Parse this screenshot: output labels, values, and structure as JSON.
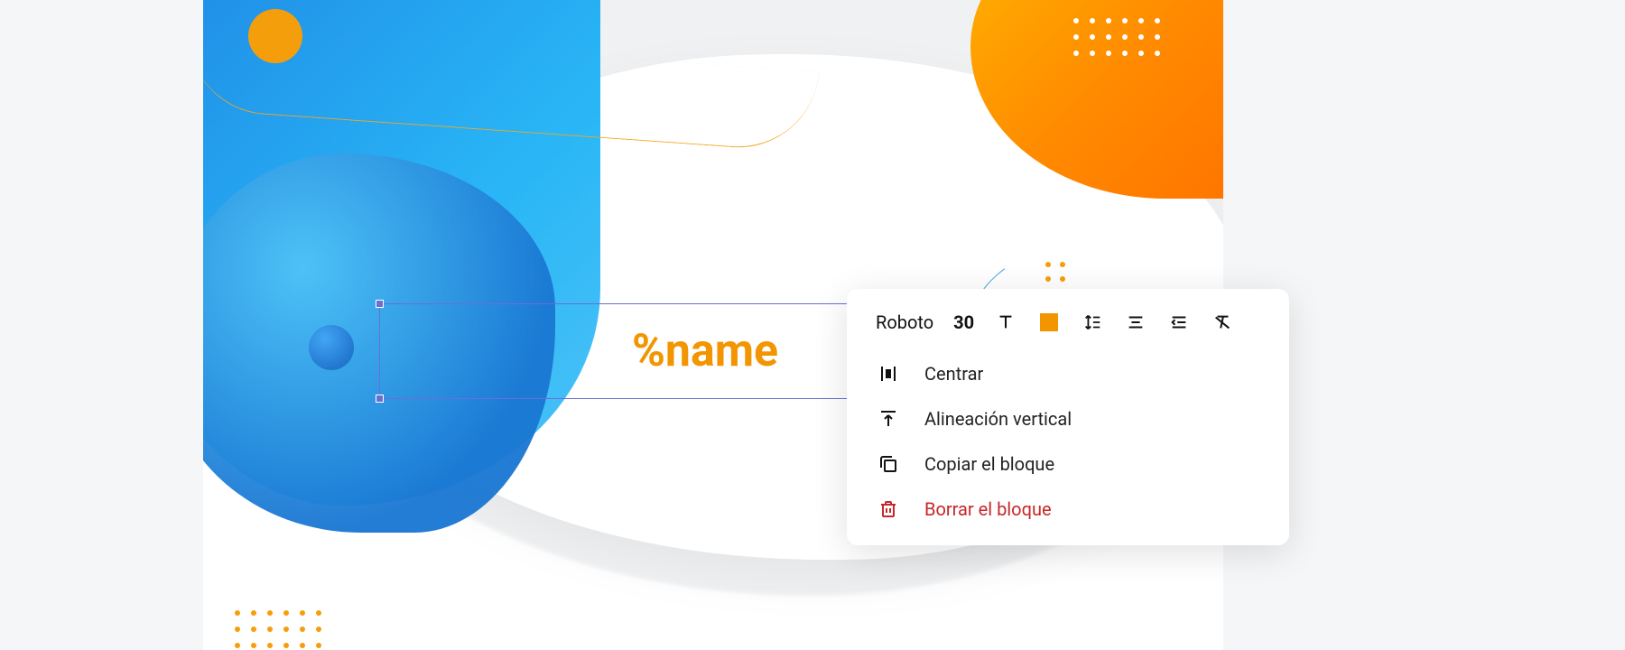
{
  "canvas": {
    "text_block_content": "%name"
  },
  "toolbar": {
    "font_name": "Roboto",
    "font_size": "30",
    "color_hex": "#f29500"
  },
  "menu": {
    "center_label": "Centrar",
    "vertical_align_label": "Alineación vertical",
    "copy_block_label": "Copiar el bloque",
    "delete_block_label": "Borrar el bloque"
  }
}
